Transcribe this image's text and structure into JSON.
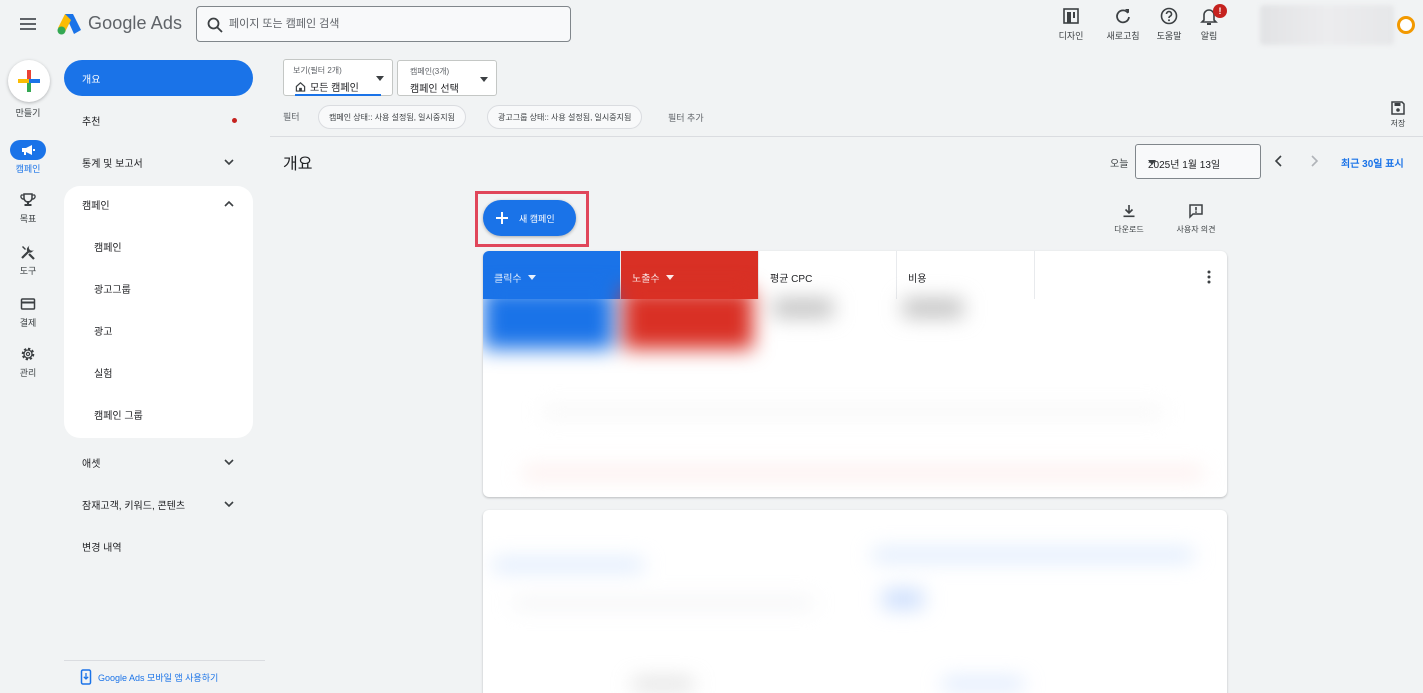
{
  "header": {
    "brand": "Google Ads",
    "search_placeholder": "페이지 또는 캠페인 검색",
    "actions": [
      {
        "label": "디자인",
        "icon": "appearance-icon"
      },
      {
        "label": "새로고침",
        "icon": "refresh-icon"
      },
      {
        "label": "도움말",
        "icon": "help-icon"
      },
      {
        "label": "알림",
        "icon": "bell-icon",
        "badge": "!"
      }
    ]
  },
  "rail": {
    "create_label": "만들기",
    "items": [
      {
        "label": "캠페인",
        "icon": "megaphone-icon",
        "active": true
      },
      {
        "label": "목표",
        "icon": "trophy-icon"
      },
      {
        "label": "도구",
        "icon": "tools-icon"
      },
      {
        "label": "결제",
        "icon": "credit-card-icon"
      },
      {
        "label": "관리",
        "icon": "gear-icon"
      }
    ]
  },
  "sidenav": {
    "overview": "개요",
    "recommendations": "추천",
    "stats_reports": "통계 및 보고서",
    "campaigns_group": "캠페인",
    "sub_items": [
      "캠페인",
      "광고그룹",
      "광고",
      "실험",
      "캠페인 그룹"
    ],
    "assets": "애셋",
    "audiences": "잠재고객, 키워드, 콘텐츠",
    "change_history": "변경 내역",
    "footer_link": "Google Ads 모바일 앱 사용하기"
  },
  "toolbar": {
    "view_small": "보기(필터 2개)",
    "view_value": "모든 캠페인",
    "campaign_small": "캠페인(3개)",
    "campaign_value": "캠페인 선택",
    "filter_label": "필터",
    "chips": [
      "캠페인 상태:: 사용 설정됨, 일시중지됨",
      "광고그룹 상태:: 사용 설정됨, 일시중지됨"
    ],
    "add_filter": "필터 추가",
    "save_label": "저장"
  },
  "overview": {
    "title": "개요",
    "today_label": "오늘",
    "date_value": "2025년 1월 13일",
    "range_link": "최근 30일 표시",
    "new_campaign": "새 캠페인",
    "download": "다운로드",
    "feedback": "사용자 의견"
  },
  "metrics": [
    {
      "name": "클릭수",
      "color": "#1a73e8",
      "dropdown": true
    },
    {
      "name": "노출수",
      "color": "#d93025",
      "dropdown": true
    },
    {
      "name": "평균 CPC",
      "color": "#ffffff"
    },
    {
      "name": "비용",
      "color": "#ffffff"
    }
  ],
  "colors": {
    "accent": "#1a73e8",
    "alert": "#c5221f",
    "highlight_border": "#e0465a"
  }
}
